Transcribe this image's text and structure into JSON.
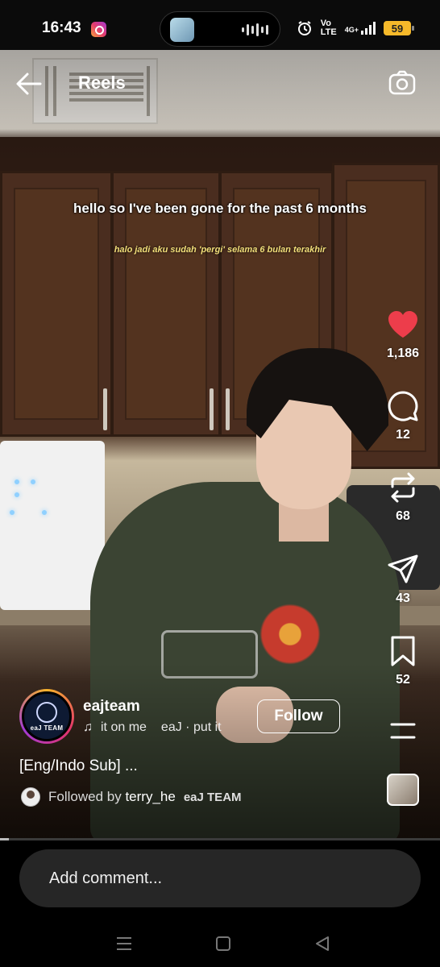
{
  "status_bar": {
    "time": "16:43",
    "network": "4G+",
    "volte_top": "Vo",
    "volte_bottom": "LTE",
    "battery": "59",
    "icons": [
      "instagram-notification-icon",
      "alarm-icon",
      "signal-icon"
    ]
  },
  "header": {
    "title": "Reels",
    "back_icon": "back-arrow-icon",
    "camera_icon": "camera-icon"
  },
  "video": {
    "caption_en": "hello so I've been gone for the past 6 months",
    "caption_id": "halo jadi aku sudah 'pergi' selama 6 bulan terakhir",
    "progress": 0.02
  },
  "actions": {
    "likes": "1,186",
    "comments": "12",
    "reposts": "68",
    "shares": "43",
    "saves": "52",
    "like_color": "#ed3d4b"
  },
  "author": {
    "avatar_text": "eaJ TEAM",
    "username": "eajteam",
    "audio_left": "it on me",
    "audio_right": "eaJ · put it",
    "follow_label": "Follow",
    "description": "[Eng/Indo Sub] ...",
    "followed_prefix": "Followed by",
    "followed_user": "terry_he",
    "watermark": "eaJ TEAM"
  },
  "comment_bar": {
    "placeholder": "Add comment..."
  }
}
